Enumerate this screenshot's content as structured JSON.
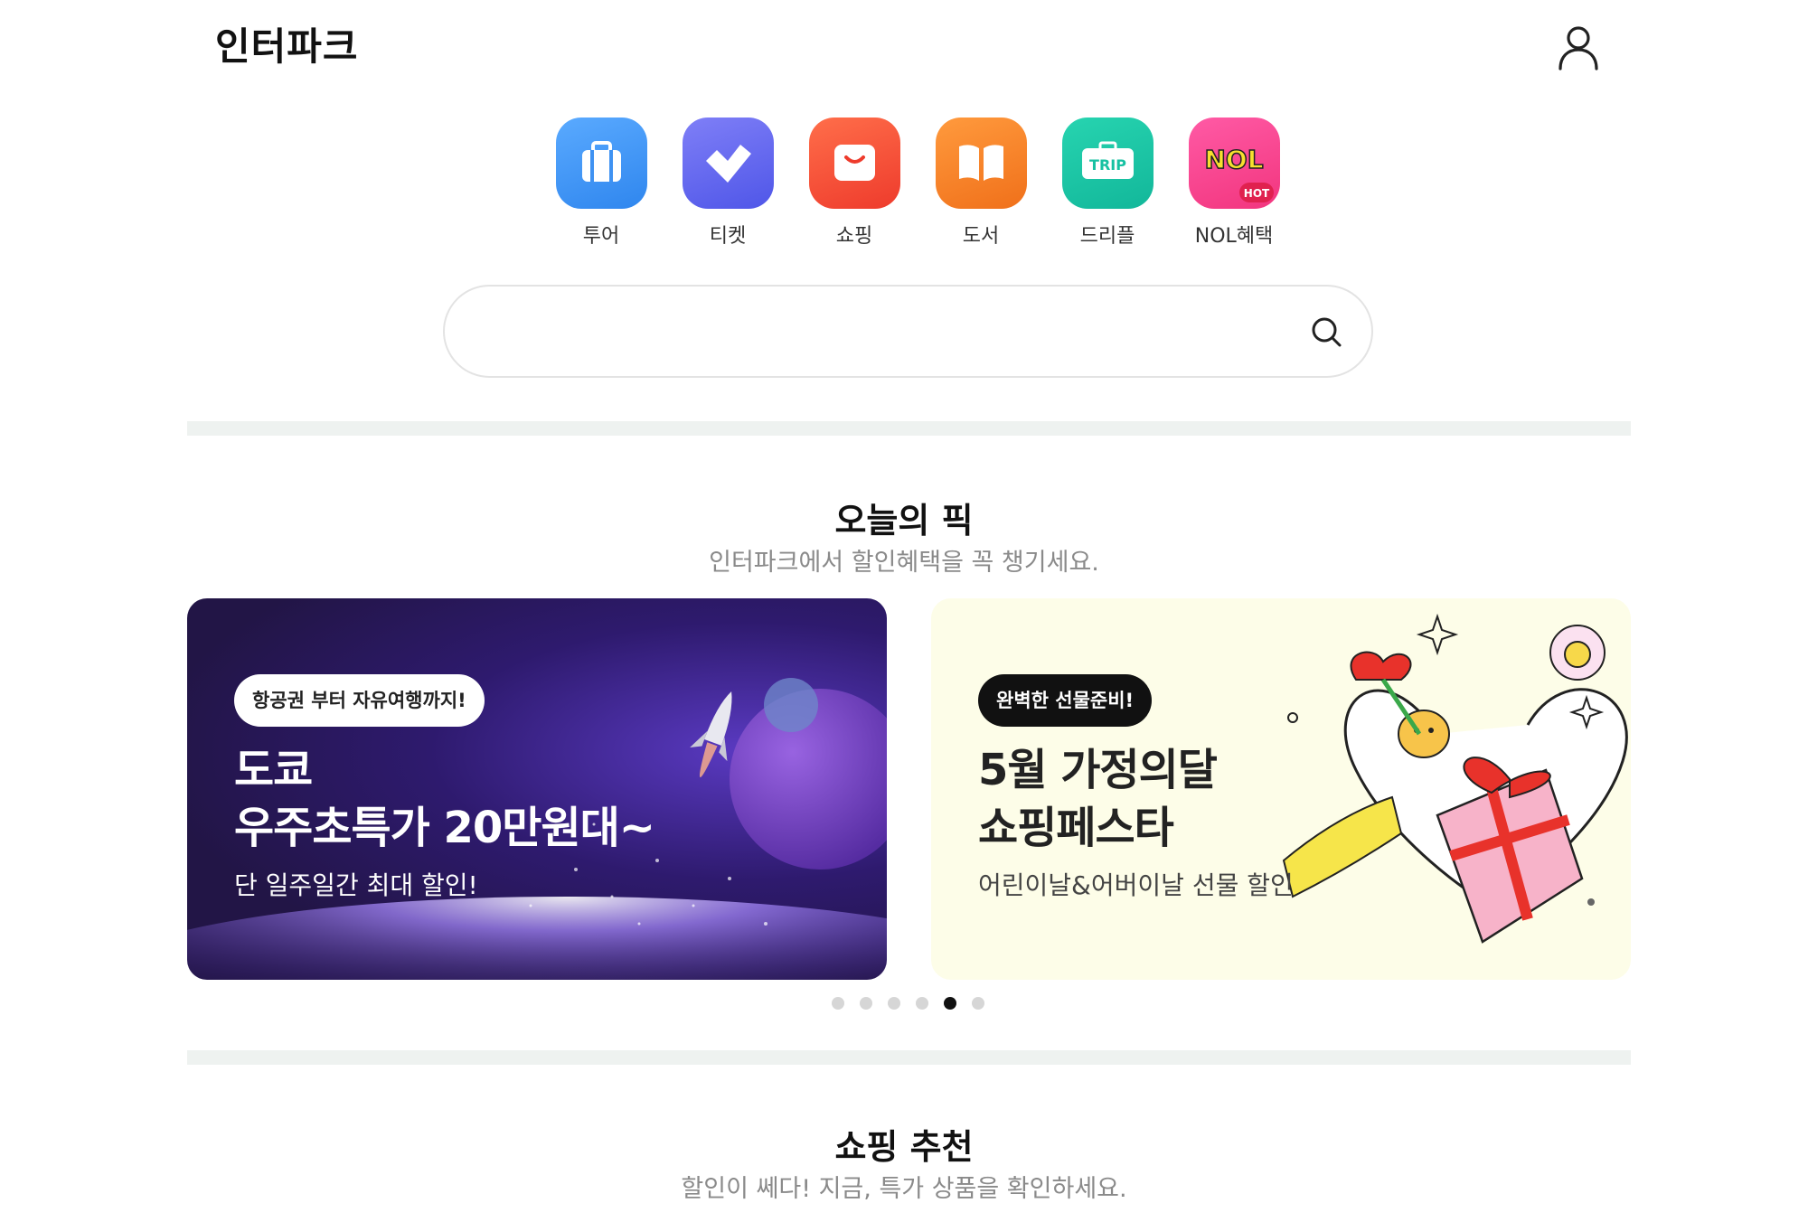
{
  "header": {
    "logo": "인터파크"
  },
  "categories": [
    {
      "label": "투어",
      "icon": "suitcase-icon",
      "color_from": "#5aaaff",
      "color_to": "#2f86ee"
    },
    {
      "label": "티켓",
      "icon": "ticket-heart-icon",
      "color_from": "#7f7ff7",
      "color_to": "#4f56e8"
    },
    {
      "label": "쇼핑",
      "icon": "shopping-bag-icon",
      "color_from": "#ff6e4a",
      "color_to": "#ee3b2c"
    },
    {
      "label": "도서",
      "icon": "book-icon",
      "color_from": "#ff9a3d",
      "color_to": "#f0701a"
    },
    {
      "label": "드리플",
      "icon": "trip-icon",
      "color_from": "#27d4b0",
      "color_to": "#12b79a",
      "badge_text": "TRIP"
    },
    {
      "label": "NOL혜택",
      "icon": "nol-icon",
      "color_from": "#ff5aa5",
      "color_to": "#f2357e",
      "logo_text": "NOL",
      "badge_text": "HOT"
    }
  ],
  "search": {
    "placeholder": ""
  },
  "todays_pick": {
    "title": "오늘의 픽",
    "subtitle": "인터파크에서 할인혜택을 꼭 챙기세요."
  },
  "banners": [
    {
      "tag": "항공권 부터 자유여행까지!",
      "title": "도쿄\n우주초특가 20만원대~",
      "desc": "단 일주일간 최대 할인!"
    },
    {
      "tag": "완벽한 선물준비!",
      "title": "5월 가정의달\n쇼핑페스타",
      "desc": "어린이날&어버이날 선물 할인"
    }
  ],
  "carousel": {
    "count": 6,
    "active_index": 4
  },
  "shopping": {
    "title": "쇼핑 추천",
    "subtitle": "할인이 쎄다! 지금, 특가 상품을 확인하세요."
  }
}
